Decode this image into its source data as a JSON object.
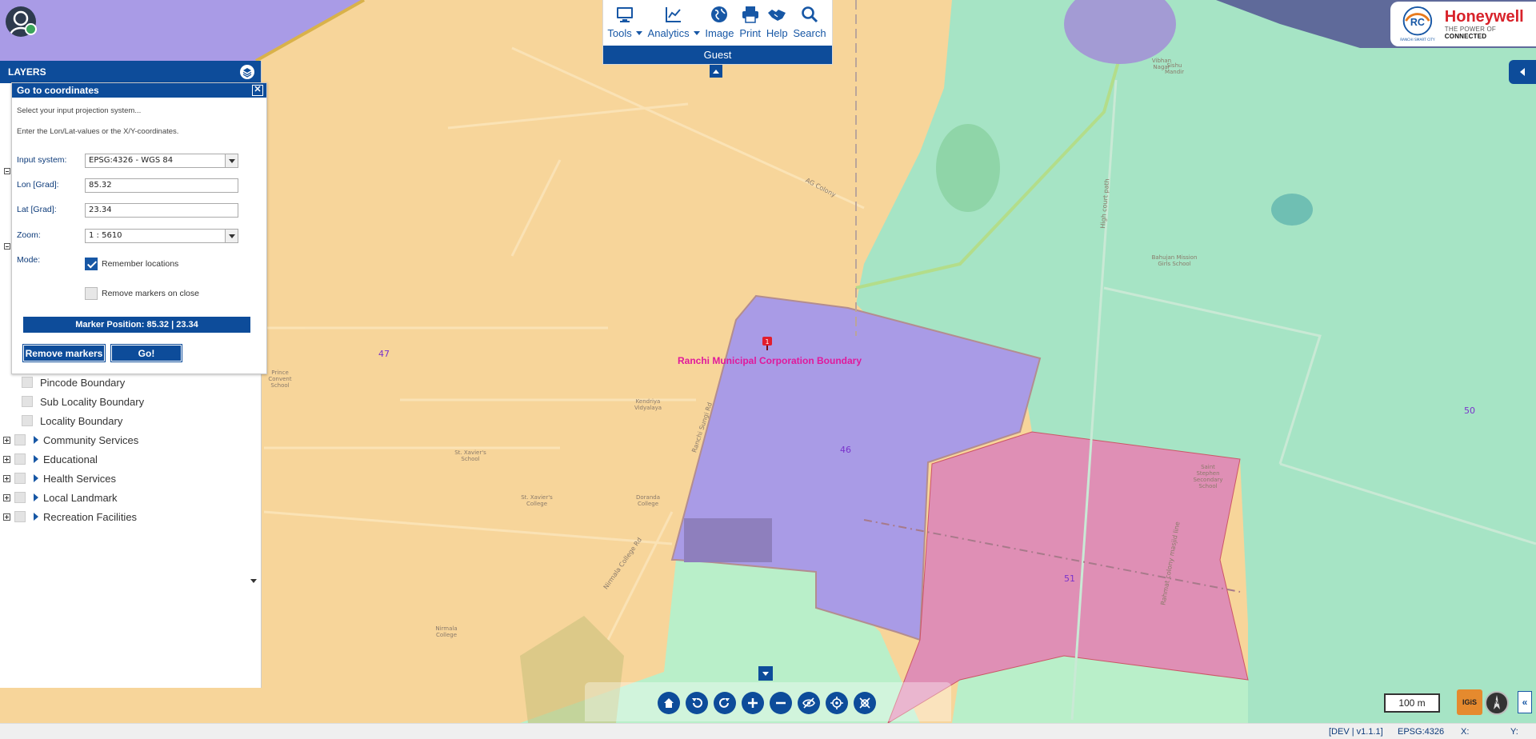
{
  "toolbar": {
    "tools": [
      {
        "label": "Tools",
        "icon": "monitor-icon",
        "dropdown": true
      },
      {
        "label": "Analytics",
        "icon": "chart-line-icon",
        "dropdown": true
      },
      {
        "label": "Image",
        "icon": "globe-icon",
        "dropdown": false
      },
      {
        "label": "Print",
        "icon": "printer-icon",
        "dropdown": false
      },
      {
        "label": "Help",
        "icon": "handshake-icon",
        "dropdown": false
      },
      {
        "label": "Search",
        "icon": "search-icon",
        "dropdown": false
      }
    ],
    "user": "Guest"
  },
  "logo": {
    "brand": "Honeywell",
    "tagline_prefix": "THE POWER OF ",
    "tagline_bold": "CONNECTED",
    "seal_text": "RANCHI SMART CITY"
  },
  "layers": {
    "title": "LAYERS",
    "items": [
      {
        "label": "Pincode Boundary",
        "type": "leaf"
      },
      {
        "label": "Sub Locality Boundary",
        "type": "leaf"
      },
      {
        "label": "Locality Boundary",
        "type": "leaf"
      },
      {
        "label": "Community Services",
        "type": "group"
      },
      {
        "label": "Educational",
        "type": "group"
      },
      {
        "label": "Health Services",
        "type": "group"
      },
      {
        "label": "Local Landmark",
        "type": "group"
      },
      {
        "label": "Recreation Facilities",
        "type": "group"
      }
    ]
  },
  "dialog": {
    "title": "Go to coordinates",
    "hint1": "Select your input projection system...",
    "hint2": "Enter the Lon/Lat-values or the X/Y-coordinates.",
    "input_system_label": "Input system:",
    "input_system_value": "EPSG:4326 - WGS 84",
    "lon_label": "Lon [Grad]:",
    "lon_value": "85.32",
    "lat_label": "Lat [Grad]:",
    "lat_value": "23.34",
    "zoom_label": "Zoom:",
    "zoom_value": "1 : 5610",
    "mode_label": "Mode:",
    "remember_label": "Remember locations",
    "remember_checked": true,
    "remove_on_close_label": "Remove markers on close",
    "remove_on_close_checked": false,
    "marker_position": "Marker Position: 85.32 | 23.34",
    "remove_markers_button": "Remove markers",
    "go_button": "Go!"
  },
  "map": {
    "boundary_label": "Ranchi Municipal Corporation Boundary",
    "wards": [
      "47",
      "46",
      "51",
      "50"
    ],
    "street_labels": [
      "AG Colony",
      "High court path",
      "Nirmala College Rd",
      "Rahmat colony masjid line",
      "Ranchi Sungi Rd"
    ],
    "place_labels": [
      "Bahujan Mission Girls School",
      "Kendriya Vidyalaya",
      "St. Xavier's School",
      "St. Xavier's College",
      "Doranda College",
      "Nirmala College",
      "Sishu Mandir",
      "Prince Convent School",
      "Saint Stephen Secondary School",
      "Vibhan Nagar"
    ]
  },
  "bottom_nav": {
    "buttons": [
      "home-icon",
      "undo-icon",
      "redo-icon",
      "zoom-in-icon",
      "zoom-out-icon",
      "hide-icon",
      "locate-icon",
      "fullscreen-off-icon"
    ]
  },
  "scale_label": "100 m",
  "igis_label": "IGiS",
  "status": {
    "version": "[DEV | v1.1.1]",
    "projection": "EPSG:4326",
    "x_label": "X:",
    "y_label": "Y:"
  },
  "colors": {
    "primary": "#0d4c9a",
    "ward_purple": "#a99be6",
    "ward_pink": "#df8fb5",
    "ward_green": "#a6e4c5",
    "ward_orange": "#f7d59a",
    "boundary_label": "#e0199c"
  }
}
